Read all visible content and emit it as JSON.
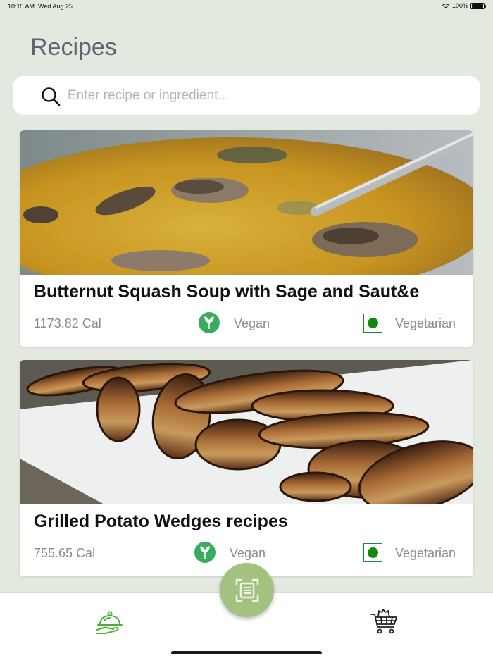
{
  "status_bar": {
    "time": "10:15 AM",
    "date": "Wed Aug 25",
    "battery": "100%"
  },
  "header": {
    "title": "Recipes"
  },
  "search": {
    "placeholder": "Enter recipe or ingredient...",
    "value": ""
  },
  "recipes": [
    {
      "title": "Butternut Squash Soup with Sage and Saut&e",
      "calories": "1173.82 Cal",
      "vegan_label": "Vegan",
      "vegetarian_label": "Vegetarian",
      "image": "soup-image"
    },
    {
      "title": "Grilled Potato Wedges recipes",
      "calories": "755.65 Cal",
      "vegan_label": "Vegan",
      "vegetarian_label": "Vegetarian",
      "image": "potato-wedges-image"
    }
  ],
  "tabs": [
    {
      "icon": "cloche-icon",
      "active": true
    },
    {
      "icon": "shopping-cart-icon",
      "active": false
    }
  ],
  "fab": {
    "icon": "scan-document-icon"
  },
  "colors": {
    "background": "#e4e9e0",
    "title": "#5c6670",
    "accent_green": "#39ab5e",
    "veg_green": "#108a10",
    "fab": "#a3c17f"
  }
}
